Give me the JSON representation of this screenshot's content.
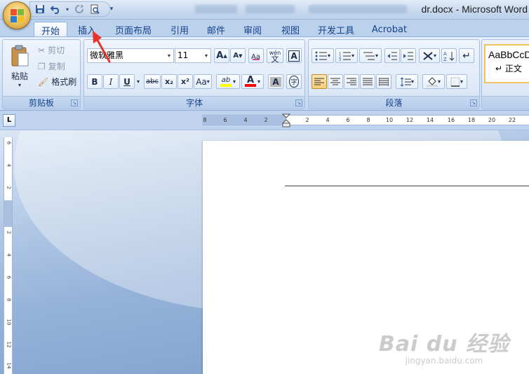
{
  "window": {
    "title": "dr.docx - Microsoft Word"
  },
  "qat": {
    "icons": [
      "save-icon",
      "undo-icon",
      "redo-icon",
      "print-preview-icon",
      "customize-icon"
    ]
  },
  "tabs": [
    {
      "label": "开始",
      "active": true
    },
    {
      "label": "插入",
      "active": false
    },
    {
      "label": "页面布局",
      "active": false
    },
    {
      "label": "引用",
      "active": false
    },
    {
      "label": "邮件",
      "active": false
    },
    {
      "label": "审阅",
      "active": false
    },
    {
      "label": "视图",
      "active": false
    },
    {
      "label": "开发工具",
      "active": false
    },
    {
      "label": "Acrobat",
      "active": false
    }
  ],
  "clipboard": {
    "paste_label": "粘贴",
    "cut_label": "剪切",
    "copy_label": "复制",
    "format_painter_label": "格式刷",
    "group_label": "剪贴板"
  },
  "font": {
    "font_name": "微软雅黑",
    "font_size": "11",
    "grow_label": "A",
    "shrink_label": "A",
    "phonetic_label": "wén",
    "bold": "B",
    "italic": "I",
    "underline": "U",
    "strike": "abc",
    "subscript": "x₂",
    "superscript": "x²",
    "change_case": "Aa",
    "highlight": "ab",
    "font_color": "A",
    "shade": "A",
    "enclose": "字",
    "group_label": "字体"
  },
  "paragraph": {
    "group_label": "段落"
  },
  "styles": {
    "sample": "AaBbCcD",
    "name": "↵ 正文"
  },
  "ruler": {
    "horizontal": [
      "8",
      "6",
      "4",
      "2",
      "2",
      "4",
      "6",
      "8",
      "10",
      "12",
      "14",
      "16",
      "18",
      "20",
      "22"
    ],
    "vertical": [
      "6",
      "4",
      "2",
      "2",
      "4",
      "6",
      "8",
      "10",
      "12",
      "14"
    ]
  },
  "watermark": {
    "line1": "Bai du 经验",
    "line2": "jingyan.baidu.com"
  },
  "colors": {
    "accent": "#15428b",
    "highlight_yellow": "#ffff00",
    "font_red": "#ff0000",
    "arrow_red": "#e8322a"
  }
}
